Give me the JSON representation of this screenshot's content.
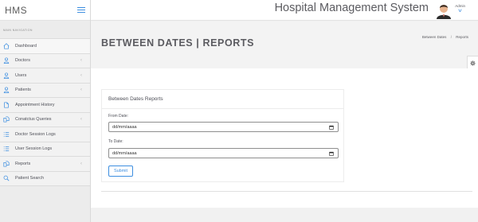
{
  "brand": {
    "name": "HMS"
  },
  "sidebar": {
    "heading": "MAIN NAVIGATION",
    "items": [
      {
        "label": "Dashboard",
        "icon": "home-icon",
        "has_submenu": false
      },
      {
        "label": "Doctors",
        "icon": "user-icon",
        "has_submenu": true
      },
      {
        "label": "Users",
        "icon": "user-icon",
        "has_submenu": true
      },
      {
        "label": "Patients",
        "icon": "user-icon",
        "has_submenu": true
      },
      {
        "label": "Appointment History",
        "icon": "file-icon",
        "has_submenu": false
      },
      {
        "label": "Conatctus Queries",
        "icon": "files-icon",
        "has_submenu": true
      },
      {
        "label": "Doctor Session Logs",
        "icon": "list-icon",
        "has_submenu": false
      },
      {
        "label": "User Session Logs",
        "icon": "list-icon",
        "has_submenu": false
      },
      {
        "label": "Reports",
        "icon": "files-icon",
        "has_submenu": true
      },
      {
        "label": "Patient Search",
        "icon": "search-icon",
        "has_submenu": false
      }
    ],
    "chevron": "‹"
  },
  "header": {
    "title": "Hospital Management System",
    "user_label": "Admin",
    "user_chevron": "v"
  },
  "page": {
    "title": "BETWEEN DATES | REPORTS",
    "breadcrumb": [
      "Between Dates",
      "Reports"
    ],
    "breadcrumb_sep": "/"
  },
  "form": {
    "title": "Between Dates Reports",
    "from_label": "From Date:",
    "from_value": "dd/mm/aaaa",
    "to_label": "To Date:",
    "to_value": "dd/mm/aaaa",
    "submit_label": "Submit"
  },
  "colors": {
    "accent": "#3d8ee0",
    "sidebar_bg": "#ececec",
    "text": "#5b5b60"
  }
}
